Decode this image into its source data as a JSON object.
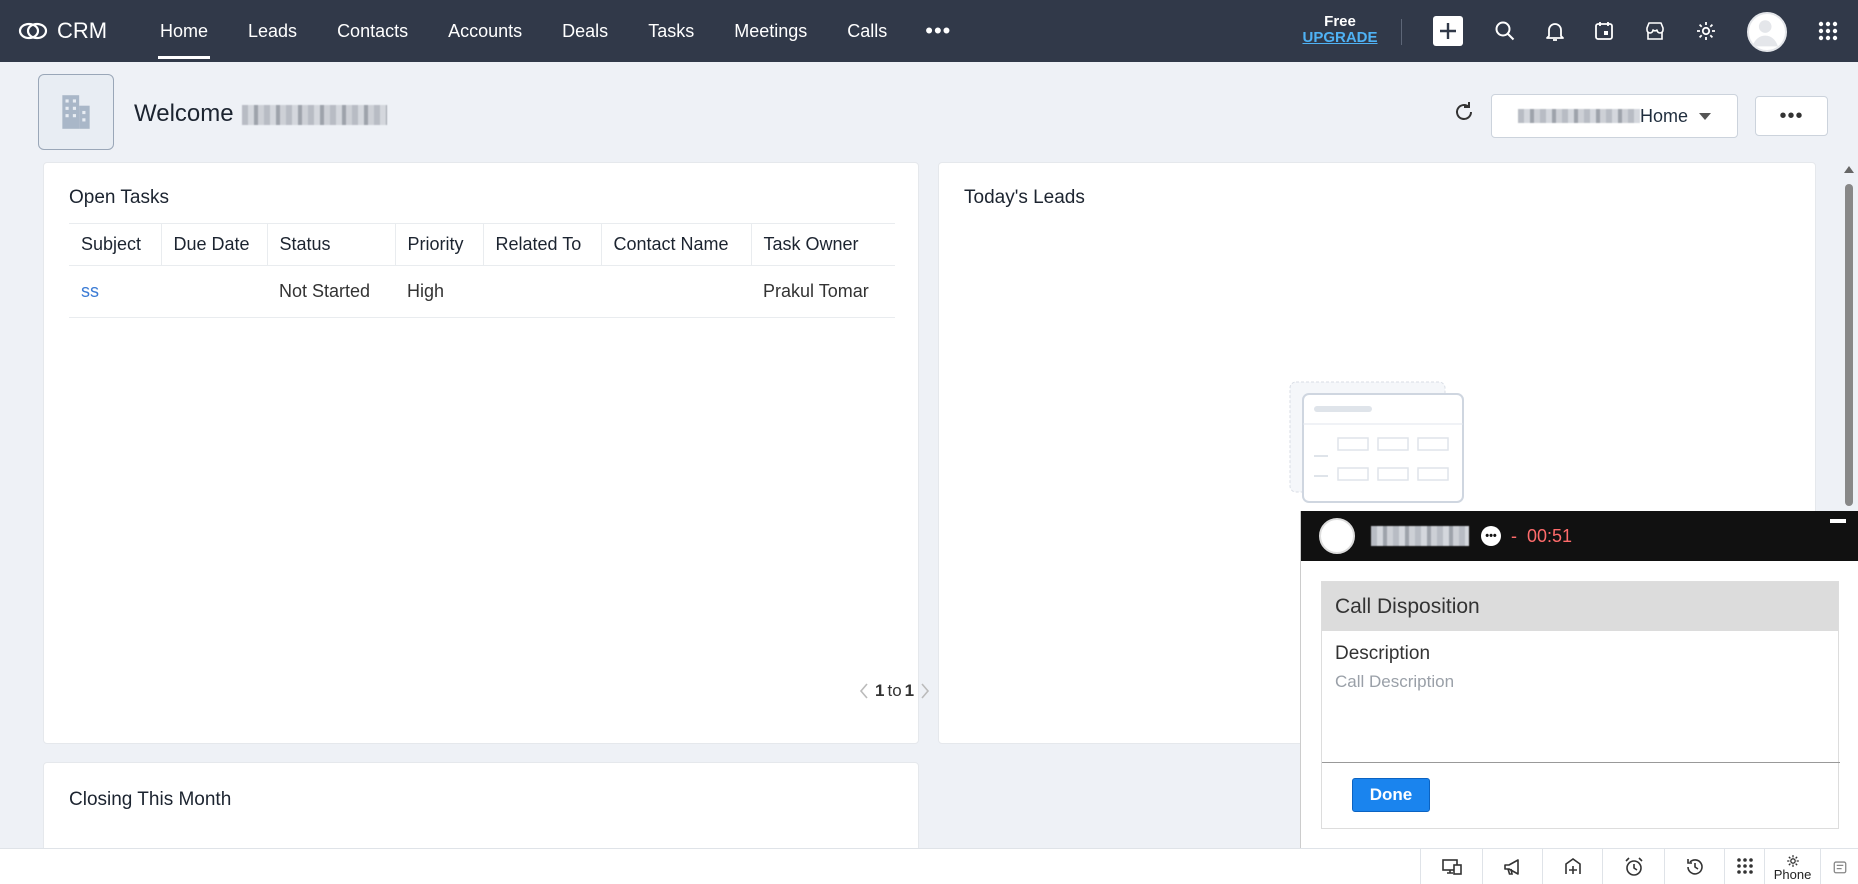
{
  "topbar": {
    "brand": "CRM",
    "nav": [
      "Home",
      "Leads",
      "Contacts",
      "Accounts",
      "Deals",
      "Tasks",
      "Meetings",
      "Calls"
    ],
    "active": "Home",
    "more": "•••",
    "plan_free": "Free",
    "plan_upgrade": "UPGRADE",
    "icons": [
      "plus-icon",
      "search-icon",
      "bell-icon",
      "calendar-icon",
      "store-icon",
      "gear-icon",
      "avatar",
      "apps-grid-icon"
    ]
  },
  "header": {
    "welcome": "Welcome",
    "home_select": "Home",
    "more": "•••"
  },
  "open_tasks": {
    "title": "Open Tasks",
    "columns": [
      "Subject",
      "Due Date",
      "Status",
      "Priority",
      "Related To",
      "Contact Name",
      "Task Owner"
    ],
    "rows": [
      {
        "subject": "ss",
        "due_date": "",
        "status": "Not Started",
        "priority": "High",
        "related_to": "",
        "contact_name": "",
        "task_owner": "Prakul Tomar"
      }
    ],
    "pager": {
      "from": "1",
      "to_label": "to",
      "to": "1"
    }
  },
  "todays_leads": {
    "title": "Today's Leads"
  },
  "closing": {
    "title": "Closing This Month"
  },
  "call": {
    "separator": "-",
    "timer": "00:51",
    "dots": "•••",
    "disposition_title": "Call Disposition",
    "description_label": "Description",
    "description_placeholder": "Call Description",
    "done": "Done"
  },
  "bottombar": {
    "phone_label": "Phone",
    "icons": [
      "screen-share-icon",
      "megaphone-icon",
      "signal-icon",
      "alarm-icon",
      "history-icon",
      "dialpad-icon",
      "phone-settings-icon",
      "notes-icon"
    ]
  },
  "colors": {
    "topbar": "#313949",
    "link": "#3a7bd5",
    "timer": "#ff6b6b",
    "done": "#1a84ee"
  }
}
